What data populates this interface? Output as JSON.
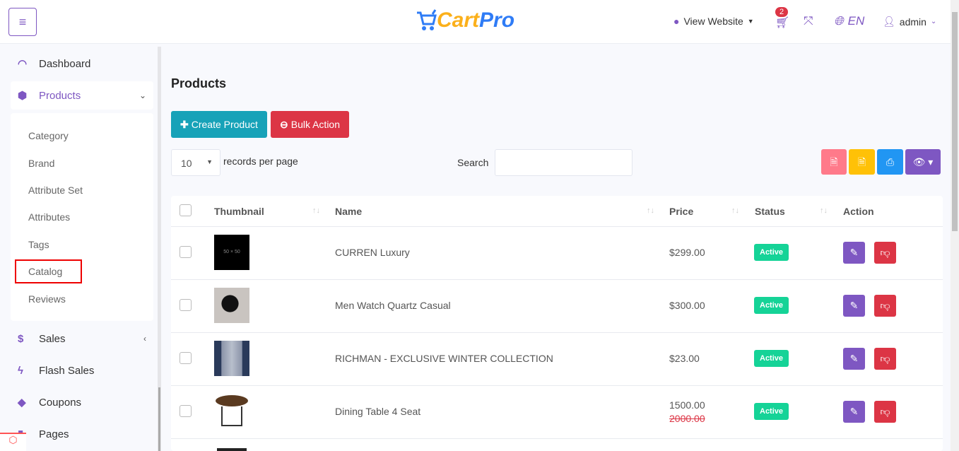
{
  "header": {
    "brand_part1": "Cart",
    "brand_part2": "Pro",
    "view_website": "View Website",
    "cart_count": "2",
    "language": "EN",
    "user": "admin"
  },
  "sidebar": {
    "items": [
      {
        "label": "Dashboard"
      },
      {
        "label": "Products"
      },
      {
        "label": "Sales"
      },
      {
        "label": "Flash Sales"
      },
      {
        "label": "Coupons"
      },
      {
        "label": "Pages"
      }
    ],
    "sub_items": [
      "Category",
      "Brand",
      "Attribute Set",
      "Attributes",
      "Tags",
      "Catalog",
      "Reviews"
    ]
  },
  "main": {
    "title": "Products",
    "create_label": "Create Product",
    "bulk_label": "Bulk Action",
    "records_value": "10",
    "records_label": "records per page",
    "search_label": "Search",
    "search_value": ""
  },
  "table": {
    "headers": [
      "Thumbnail",
      "Name",
      "Price",
      "Status",
      "Action"
    ],
    "rows": [
      {
        "thumb": "50 × 50",
        "name": "CURREN Luxury",
        "price": "$299.00",
        "old_price": "",
        "status": "Active"
      },
      {
        "thumb": "",
        "name": "Men Watch Quartz Casual",
        "price": "$300.00",
        "old_price": "",
        "status": "Active"
      },
      {
        "thumb": "",
        "name": "RICHMAN - EXCLUSIVE WINTER COLLECTION",
        "price": "$23.00",
        "old_price": "",
        "status": "Active"
      },
      {
        "thumb": "",
        "name": "Dining Table 4 Seat",
        "price": "1500.00",
        "old_price": "2000.00",
        "status": "Active"
      }
    ]
  },
  "colors": {
    "accent": "#7e57c2",
    "primary": "#17a2b8",
    "danger": "#dc3545",
    "success": "#15d397"
  }
}
